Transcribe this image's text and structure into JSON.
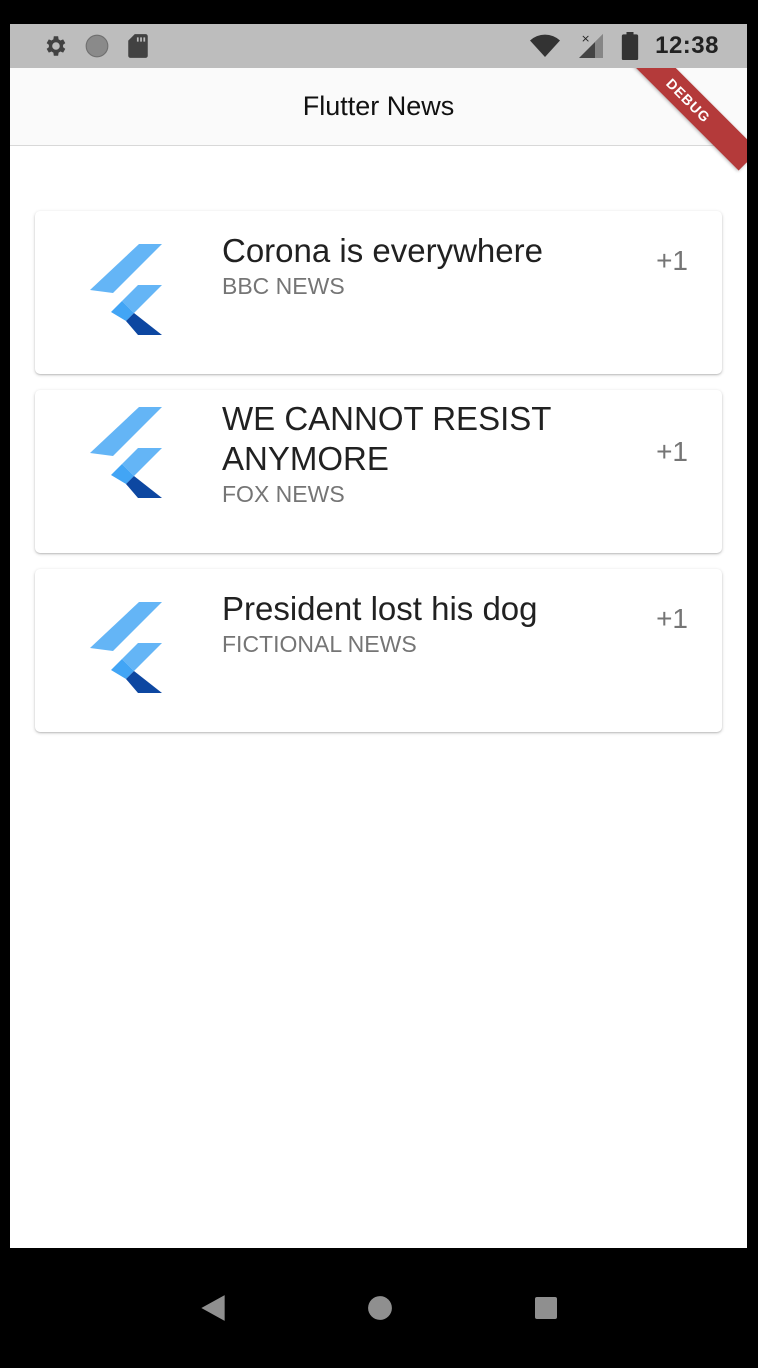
{
  "status_bar": {
    "time": "12:38",
    "icons": [
      "gear-icon",
      "circle-icon",
      "sd-card-icon",
      "wifi-icon",
      "signal-icon",
      "battery-icon"
    ]
  },
  "app_bar": {
    "title": "Flutter News",
    "debug_label": "DEBUG"
  },
  "news": [
    {
      "title": "Corona is everywhere",
      "source": "BBC NEWS",
      "count": "+1"
    },
    {
      "title": "WE CANNOT RESIST ANYMORE",
      "source": "FOX NEWS",
      "count": "+1"
    },
    {
      "title": "President lost his dog",
      "source": "FICTIONAL NEWS",
      "count": "+1"
    }
  ],
  "colors": {
    "status_bar": "#bdbdbd",
    "app_bar": "#fafafa",
    "flutter_light": "#64b5f6",
    "flutter_mid": "#42a5f5",
    "flutter_dark": "#0d47a1",
    "debug_ribbon": "#b43a3a"
  }
}
